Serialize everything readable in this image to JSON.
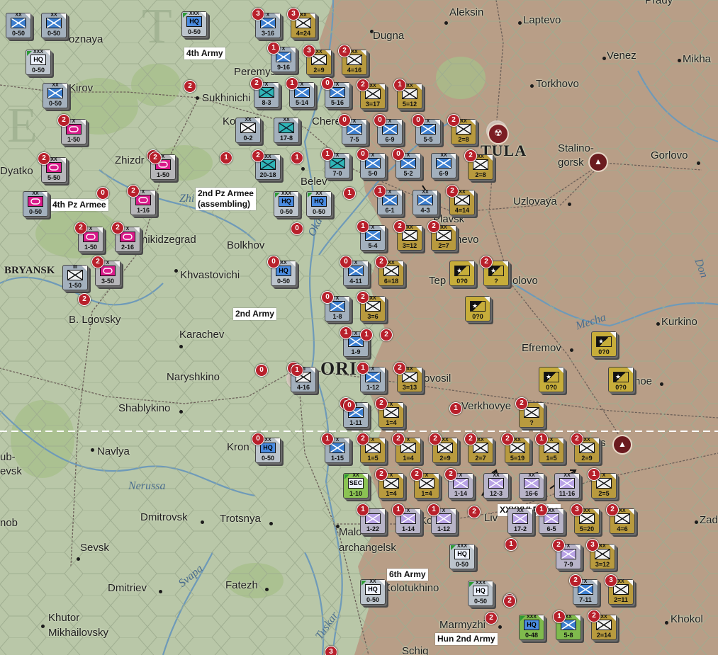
{
  "map": {
    "colors": {
      "axis_counter": "#b89a3e",
      "soviet_counter": "#a3b0bd",
      "soviet_inf": "#3d7fd0",
      "cavalry": "#2fb5b7",
      "tank_magenta": "#d91a8a",
      "hungarian": "#7fba4d",
      "axis_controlled": "#b79a84",
      "soviet_controlled": "#b9c7a8",
      "marker_red": "#b8202b"
    }
  },
  "cities": {
    "aleksin": "Aleksin",
    "laptevo": "Laptevo",
    "prady": "Prady",
    "dugna": "Dugna",
    "venez": "Venez",
    "mikha": "Mikha",
    "koznaya": "oznaya",
    "peremyshl": "Peremyshl",
    "torkhovo": "Torkhovo",
    "kirov": "Kirov",
    "sukhinichi": "Sukhinichi",
    "kozelsk": "Kozelsk",
    "cherepet": "Chere",
    "tula": "TULA",
    "stalinogorsk": "Stalino-\ngorsk",
    "gorlovo": "Gorlovo",
    "dyatkovo": "Dyatko",
    "zhizdra": "Zhizdr",
    "belev": "Belev",
    "uzlovaya": "Uzlovaya",
    "plavsk": "Plavsk",
    "chernevo": "hevo",
    "ordzhonikidzegrad": "nikidzegrad",
    "bolkhov": "Bolkhov",
    "bryansk": "BRYANSK",
    "khvastovichi": "Khvastovichi",
    "teploe": "Tep",
    "volovo": "olovo",
    "don": "Don",
    "b_lgovsky": "B. Lgovsky",
    "karachev": "Karachev",
    "mecha": "Mecha",
    "kurkino": "Kurkino",
    "efremov": "Efremov",
    "orel": "ORI",
    "naryshkino": "Naryshkino",
    "novosil": "ovosil",
    "krasnoe": "noe",
    "verkhovye": "Verkhovye",
    "shablykino": "Shablykino",
    "navlya": "Navlya",
    "kromy": "Kron",
    "livny_top": "ts",
    "sevsk_top": "ub-\nevsk",
    "nerussa": "Nerussa",
    "dmitrovsk": "Dmitrovsk",
    "trostnya": "Trotsnya",
    "zad": "Zad",
    "komy": "nob",
    "maloarkhangelsk": "Malo\narchangelsk",
    "sevsk": "Sevsk",
    "kolpny": "Ko",
    "livny": "Liv",
    "svapa": "Svapa",
    "fatezh": "Fatezh",
    "kolotukhino": "Kolotukhino",
    "dmitriev": "Dmitriev",
    "tuskar": "Tuskar",
    "khutor": "Khutor\nMikhailovsky",
    "marmyzhi": "Marmyzhi",
    "khokhol": "Khokol",
    "schigry": "Schig",
    "zhizdra_river": "Zhi",
    "oka": "Oka"
  },
  "army_labels": {
    "a4": "4th Army",
    "pz2": "2nd Pz Armee\n(assembling)",
    "pz4": "4th Pz Armee",
    "a2": "2nd Army",
    "a6": "6th Army",
    "pz48": "XXXXVI PzKps",
    "hun2": "Hun 2nd Army"
  },
  "counters": [
    {
      "t": "c-sov",
      "s": "inf-blue",
      "sz": "XX",
      "str": "0-50",
      "b": ""
    },
    {
      "t": "c-sov",
      "s": "inf-blue",
      "sz": "XX",
      "str": "0-50",
      "b": ""
    },
    {
      "t": "c-hq",
      "s": "hq-w",
      "sz": "XXX",
      "str": "0-50",
      "b": "",
      "hq": "HQ"
    },
    {
      "t": "c-hq",
      "s": "hq-blue",
      "sz": "XXX",
      "str": "0-50",
      "b": "",
      "hq": "HQ"
    },
    {
      "t": "c-sov",
      "s": "inf-blue",
      "sz": "XX",
      "str": "0-50",
      "b": ""
    },
    {
      "t": "c-pink",
      "s": "mag",
      "sz": "X",
      "str": "1-50",
      "b": "2"
    },
    {
      "t": "c-pink",
      "s": "mag",
      "sz": "XX",
      "str": "5-50",
      "b": "2"
    },
    {
      "t": "c-pink",
      "s": "mag",
      "sz": "X",
      "str": "1-50",
      "b": "2"
    },
    {
      "t": "c-pink",
      "s": "mag",
      "sz": "X",
      "str": "1-16",
      "b": "2"
    },
    {
      "t": "c-sov",
      "s": "mag",
      "sz": "XX",
      "str": "0-50",
      "b": ""
    },
    {
      "t": "c-pink",
      "s": "mag",
      "sz": "X",
      "str": "1-50",
      "b": "2"
    },
    {
      "t": "c-pink",
      "s": "mag",
      "sz": "X",
      "str": "2-16",
      "b": "2"
    },
    {
      "t": "c-pink",
      "s": "mag",
      "sz": "X",
      "str": "3-50",
      "b": "2"
    },
    {
      "t": "c-sov",
      "s": "axis-w",
      "sz": "III",
      "str": "1-50",
      "b": ""
    },
    {
      "t": "c-sov",
      "s": "inf-blue",
      "sz": "X",
      "str": "3-16",
      "b": "3"
    },
    {
      "t": "c-axis",
      "s": "axis-w",
      "sz": "XX",
      "str": "4=24",
      "b": "3"
    },
    {
      "t": "c-sov",
      "s": "inf-blue",
      "sz": "X",
      "str": "9-16",
      "b": "1"
    },
    {
      "t": "c-axis",
      "s": "axis-w",
      "sz": "XX",
      "str": "2=9",
      "b": "3"
    },
    {
      "t": "c-axis",
      "s": "axis-w",
      "sz": "XX",
      "str": "4=16",
      "b": "2"
    },
    {
      "t": "c-sov",
      "s": "cav",
      "sz": "X",
      "str": "8-3",
      "b": "2"
    },
    {
      "t": "c-sov",
      "s": "inf-blue",
      "sz": "X",
      "str": "5-14",
      "b": "1"
    },
    {
      "t": "c-sov",
      "s": "inf-blue",
      "sz": "X",
      "str": "5-16",
      "b": "0"
    },
    {
      "t": "c-axis",
      "s": "axis-w",
      "sz": "XX",
      "str": "3=17",
      "b": "2"
    },
    {
      "t": "c-axis",
      "s": "axis-w",
      "sz": "XX",
      "str": "5=12",
      "b": "1"
    },
    {
      "t": "c-sov",
      "s": "axis-w",
      "sz": "XX",
      "str": "0-2",
      "b": ""
    },
    {
      "t": "c-sov",
      "s": "cav",
      "sz": "XX",
      "str": "17-8",
      "b": ""
    },
    {
      "t": "c-sov",
      "s": "inf-blue",
      "sz": "X",
      "str": "7-5",
      "b": "0"
    },
    {
      "t": "c-sov",
      "s": "inf-blue",
      "sz": "X",
      "str": "6-9",
      "b": "0"
    },
    {
      "t": "c-sov",
      "s": "inf-blue",
      "sz": "X",
      "str": "5-5",
      "b": "0"
    },
    {
      "t": "c-axis",
      "s": "axis-w",
      "sz": "XX",
      "str": "2=8",
      "b": "2"
    },
    {
      "t": "c-sov",
      "s": "cav",
      "sz": "XX",
      "str": "20-18",
      "b": "2"
    },
    {
      "t": "c-sov",
      "s": "cav",
      "sz": "X",
      "str": "7-0",
      "b": "1"
    },
    {
      "t": "c-sov",
      "s": "inf-blue",
      "sz": "X",
      "str": "5-0",
      "b": "0"
    },
    {
      "t": "c-sov",
      "s": "inf-blue",
      "sz": "X",
      "str": "5-2",
      "b": "0"
    },
    {
      "t": "c-sov",
      "s": "inf-blue",
      "sz": "XX",
      "str": "6-9",
      "b": ""
    },
    {
      "t": "c-axis",
      "s": "axis-w",
      "sz": "XX",
      "str": "2=8",
      "b": "2"
    },
    {
      "t": "c-hq",
      "s": "hq-blue",
      "sz": "XXX",
      "str": "0-50",
      "b": "",
      "hq": "HQ"
    },
    {
      "t": "c-hq",
      "s": "hq-blue",
      "sz": "XX",
      "str": "0-50",
      "b": "",
      "hq": "HQ"
    },
    {
      "t": "c-sov",
      "s": "inf-blue",
      "sz": "X",
      "str": "6-1",
      "b": "1"
    },
    {
      "t": "c-sov",
      "s": "inf-blue",
      "sz": "XX",
      "str": "4-3",
      "b": ""
    },
    {
      "t": "c-axis",
      "s": "axis-w",
      "sz": "XX",
      "str": "4=14",
      "b": "2"
    },
    {
      "t": "c-sov",
      "s": "inf-blue",
      "sz": "X",
      "str": "5-4",
      "b": "1"
    },
    {
      "t": "c-axis",
      "s": "axis-w",
      "sz": "XX",
      "str": "3=12",
      "b": "2"
    },
    {
      "t": "c-axis",
      "s": "axis-w",
      "sz": "XX",
      "str": "2=7",
      "b": "2"
    },
    {
      "t": "c-hq",
      "s": "hq-blue",
      "sz": "XX",
      "str": "0-50",
      "b": "0",
      "hq": "HQ"
    },
    {
      "t": "c-sov",
      "s": "inf-blue",
      "sz": "X",
      "str": "4-11",
      "b": "0"
    },
    {
      "t": "c-axis",
      "s": "axis-w",
      "sz": "XX",
      "str": "6=18",
      "b": "2"
    },
    {
      "t": "c-part",
      "s": "",
      "sz": "",
      "str": "0?0",
      "b": ""
    },
    {
      "t": "c-part",
      "s": "",
      "sz": "",
      "str": "?",
      "b": "2"
    },
    {
      "t": "c-sov",
      "s": "inf-blue",
      "sz": "X",
      "str": "1-8",
      "b": "0"
    },
    {
      "t": "c-axis",
      "s": "axis-w",
      "sz": "XX",
      "str": "3=6",
      "b": "2"
    },
    {
      "t": "c-part",
      "s": "",
      "sz": "",
      "str": "0?0",
      "b": ""
    },
    {
      "t": "c-sov",
      "s": "inf-blue",
      "sz": "X",
      "str": "1-9",
      "b": "1"
    },
    {
      "t": "c-part",
      "s": "",
      "sz": "",
      "str": "0?0",
      "b": ""
    },
    {
      "t": "c-sov",
      "s": "axis-w",
      "sz": "III",
      "str": "4-16",
      "b": "1"
    },
    {
      "t": "c-sov",
      "s": "inf-blue",
      "sz": "X",
      "str": "1-12",
      "b": "1"
    },
    {
      "t": "c-axis",
      "s": "axis-w",
      "sz": "XX",
      "str": "3=13",
      "b": "2"
    },
    {
      "t": "c-part",
      "s": "",
      "sz": "",
      "str": "0?0",
      "b": ""
    },
    {
      "t": "c-part",
      "s": "",
      "sz": "",
      "str": "0?0",
      "b": ""
    },
    {
      "t": "c-sov",
      "s": "inf-blue",
      "sz": "X",
      "str": "1-11",
      "b": "0"
    },
    {
      "t": "c-axis",
      "s": "axis-w",
      "sz": "X",
      "str": "1=4",
      "b": "2"
    },
    {
      "t": "c-axis",
      "s": "axis-w",
      "sz": "",
      "str": "?",
      "b": "2"
    },
    {
      "t": "c-hq",
      "s": "hq-blue",
      "sz": "XX",
      "str": "0-50",
      "b": "0",
      "hq": "HQ"
    },
    {
      "t": "c-sov",
      "s": "inf-blue",
      "sz": "X",
      "str": "1-15",
      "b": "1"
    },
    {
      "t": "c-axis",
      "s": "axis-w",
      "sz": "X",
      "str": "1=5",
      "b": "2"
    },
    {
      "t": "c-axis",
      "s": "axis-w",
      "sz": "X",
      "str": "1=4",
      "b": "2"
    },
    {
      "t": "c-axis",
      "s": "axis-w",
      "sz": "XX",
      "str": "2=9",
      "b": "2"
    },
    {
      "t": "c-axis",
      "s": "axis-w",
      "sz": "XX",
      "str": "2=7",
      "b": "2"
    },
    {
      "t": "c-axis",
      "s": "axis-w",
      "sz": "XX",
      "str": "5=19",
      "b": "2"
    },
    {
      "t": "c-axis",
      "s": "axis-w",
      "sz": "X",
      "str": "1=5",
      "b": "1"
    },
    {
      "t": "c-axis",
      "s": "axis-w",
      "sz": "XX",
      "str": "2=9",
      "b": "2"
    },
    {
      "t": "c-green",
      "s": "hq-w",
      "sz": "XX",
      "str": "1-10",
      "b": "",
      "hq": "SEC"
    },
    {
      "t": "c-axis",
      "s": "axis-w",
      "sz": "X",
      "str": "1=4",
      "b": "2"
    },
    {
      "t": "c-axis",
      "s": "axis-w",
      "sz": "X",
      "str": "1=4",
      "b": "2"
    },
    {
      "t": "c-purp",
      "s": "purp-l",
      "sz": "X",
      "str": "1-14",
      "b": "2"
    },
    {
      "t": "c-purp",
      "s": "purp-l",
      "sz": "XX",
      "str": "12-3",
      "b": ""
    },
    {
      "t": "c-purp",
      "s": "purp-l",
      "sz": "XX",
      "str": "16-6",
      "b": ""
    },
    {
      "t": "c-purp",
      "s": "purp-l",
      "sz": "XX",
      "str": "11-16",
      "b": ""
    },
    {
      "t": "c-axis",
      "s": "axis-w",
      "sz": "X",
      "str": "2=5",
      "b": "1"
    },
    {
      "t": "c-purp",
      "s": "purp-l",
      "sz": "",
      "str": "1-22",
      "b": "1"
    },
    {
      "t": "c-purp",
      "s": "purp-l",
      "sz": "X",
      "str": "1-14",
      "b": "1"
    },
    {
      "t": "c-purp",
      "s": "purp-l",
      "sz": "X",
      "str": "1-12",
      "b": "1"
    },
    {
      "t": "c-purp",
      "s": "purp-l",
      "sz": "XX",
      "str": "17-2",
      "b": ""
    },
    {
      "t": "c-purp",
      "s": "purp-l",
      "sz": "XX",
      "str": "6-5",
      "b": "1"
    },
    {
      "t": "c-axis",
      "s": "axis-w",
      "sz": "XX",
      "str": "5=20",
      "b": "3"
    },
    {
      "t": "c-axis",
      "s": "axis-w",
      "sz": "XX",
      "str": "4=6",
      "b": "2"
    },
    {
      "t": "c-hq",
      "s": "hq-w",
      "sz": "XXX",
      "str": "0-50",
      "b": "",
      "hq": "HQ"
    },
    {
      "t": "c-purp",
      "s": "purp-l",
      "sz": "X",
      "str": "7-9",
      "b": "2"
    },
    {
      "t": "c-axis",
      "s": "axis-w",
      "sz": "XX",
      "str": "3=12",
      "b": "3"
    },
    {
      "t": "c-hq",
      "s": "hq-w",
      "sz": "XX",
      "str": "0-50",
      "b": "",
      "hq": "HQ"
    },
    {
      "t": "c-sov",
      "s": "inf-blue",
      "sz": "X",
      "str": "7-11",
      "b": "2"
    },
    {
      "t": "c-axis",
      "s": "axis-w",
      "sz": "XX",
      "str": "2=11",
      "b": "3"
    },
    {
      "t": "c-hq",
      "s": "hq-w",
      "sz": "XXX",
      "str": "0-50",
      "b": "",
      "hq": "HQ"
    },
    {
      "t": "c-hun",
      "s": "hq-blue",
      "sz": "XXX",
      "str": "0-48",
      "b": "",
      "hq": "HQ"
    },
    {
      "t": "c-hun",
      "s": "inf-blue",
      "sz": "XX",
      "str": "5-8",
      "b": ""
    },
    {
      "t": "c-axis",
      "s": "axis-w",
      "sz": "XX",
      "str": "2=14",
      "b": "2"
    }
  ],
  "loose_markers": [
    "2",
    "1",
    "1",
    "0",
    "2",
    "0",
    "1",
    "0",
    "1",
    "2",
    "0",
    "2",
    "1",
    "2",
    "2",
    "2",
    "1",
    "1",
    "1",
    "1",
    "3"
  ]
}
